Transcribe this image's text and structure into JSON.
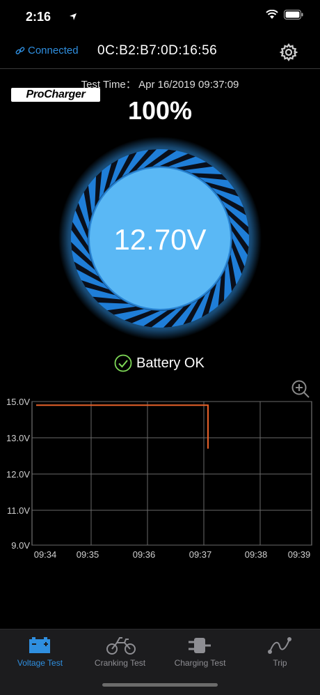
{
  "status": {
    "time": "2:16"
  },
  "header": {
    "connected_label": "Connected",
    "mac_address": "0C:B2:B7:0D:16:56"
  },
  "test": {
    "time_label": "Test Time： Apr 16/2019 09:37:09",
    "percent": "100%"
  },
  "logo": {
    "text": "ProCharger"
  },
  "gauge": {
    "voltage": "12.70V"
  },
  "battery_status": "Battery OK",
  "chart_data": {
    "type": "line",
    "x_ticks": [
      "09:34",
      "09:35",
      "09:36",
      "09:37",
      "09:38",
      "09:39"
    ],
    "y_ticks": [
      "15.0V",
      "13.0V",
      "12.0V",
      "11.0V",
      "9.0V"
    ],
    "series": [
      {
        "points": [
          [
            "09:34",
            14.8
          ],
          [
            "09:37",
            14.8
          ],
          [
            "09:37",
            12.7
          ]
        ],
        "color": "#e8622a"
      }
    ],
    "grid": true
  },
  "tabs": [
    {
      "label": "Voltage Test",
      "icon": "battery-icon",
      "active": true
    },
    {
      "label": "Cranking Test",
      "icon": "motorcycle-icon",
      "active": false
    },
    {
      "label": "Charging Test",
      "icon": "plug-icon",
      "active": false
    },
    {
      "label": "Trip",
      "icon": "route-icon",
      "active": false
    }
  ],
  "colors": {
    "accent": "#2f8fe0",
    "gauge": "#5ab8f5",
    "line": "#e8622a",
    "ok": "#7ed957"
  }
}
